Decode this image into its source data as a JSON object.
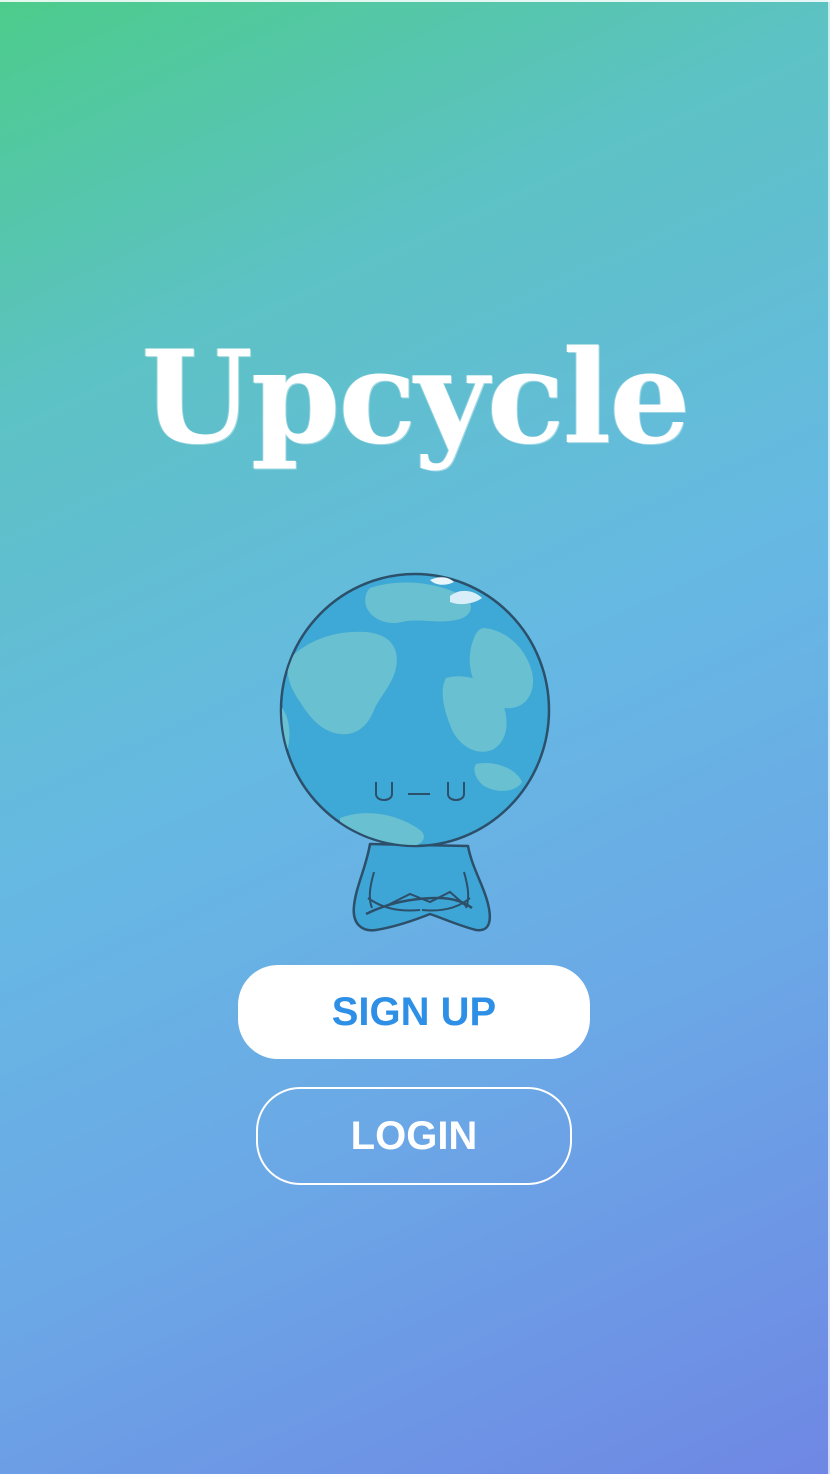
{
  "app": {
    "title": "Upcycle"
  },
  "buttons": {
    "signup_label": "SIGN UP",
    "login_label": "LOGIN"
  },
  "mascot": {
    "icon": "earth-mascot-icon",
    "face": "U — U"
  },
  "colors": {
    "gradient_top_left": "#4ccc8b",
    "gradient_middle": "#66b9e3",
    "gradient_bottom_right": "#6f87e4",
    "signup_text": "#2e8fe6",
    "globe_ocean": "#3ea8d6",
    "globe_land": "#68c0d0"
  }
}
